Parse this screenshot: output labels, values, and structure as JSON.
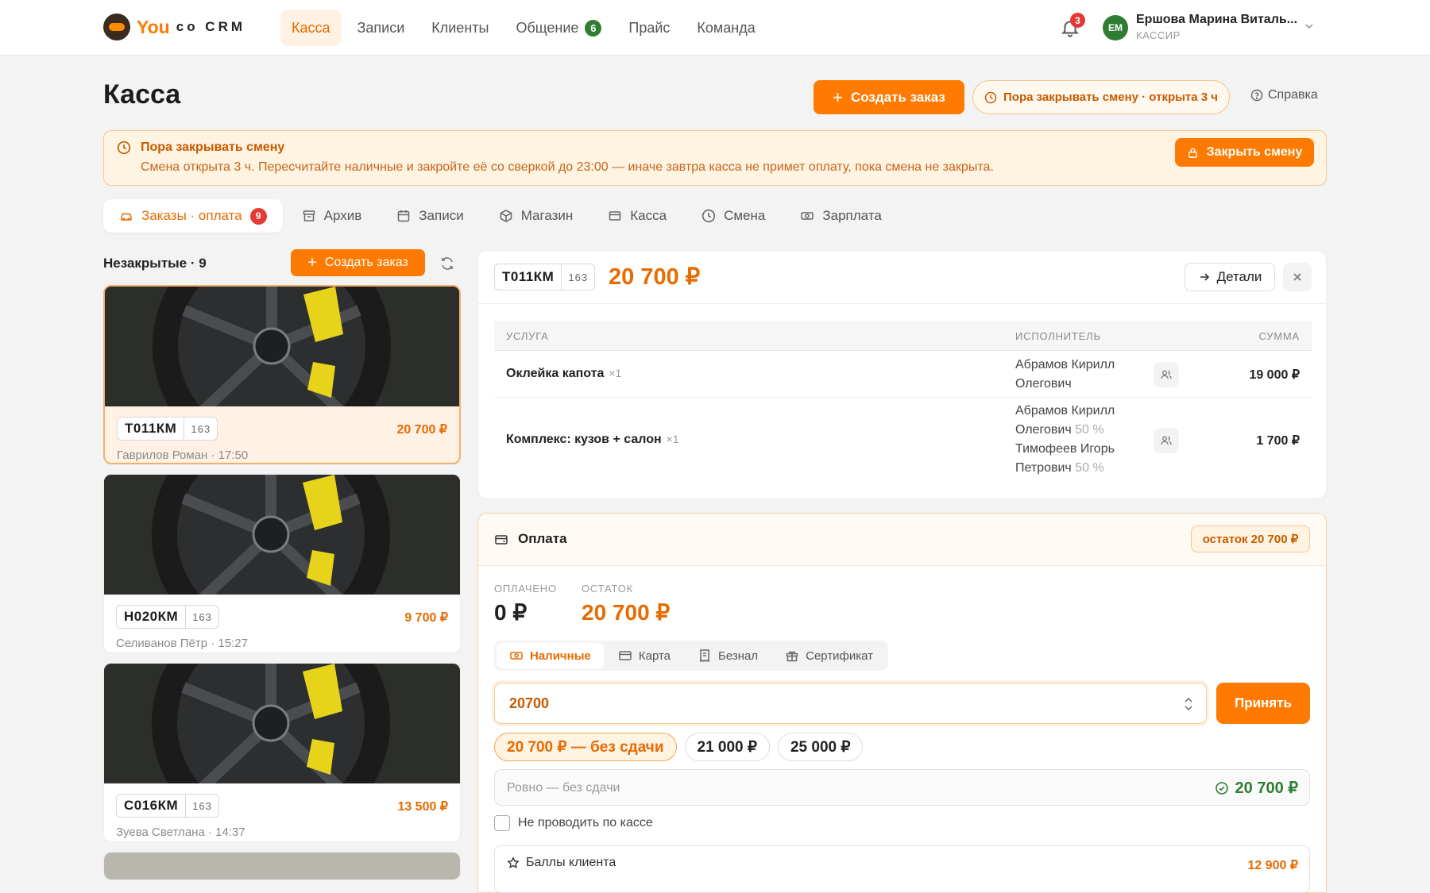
{
  "app": {
    "brand_you": "You",
    "brand_co": "co CRM"
  },
  "nav": [
    {
      "label": "Касса",
      "active": true
    },
    {
      "label": "Записи"
    },
    {
      "label": "Клиенты"
    },
    {
      "label": "Общение",
      "badge": "6"
    },
    {
      "label": "Прайс"
    },
    {
      "label": "Команда"
    }
  ],
  "notifications": {
    "count": "3"
  },
  "user": {
    "initials": "ЕМ",
    "name": "Ершова Марина Виталь...",
    "role": "КАССИР"
  },
  "header": {
    "title": "Касса",
    "create_label": "Создать заказ",
    "shift_label": "Пора закрывать смену · открыта 3 ч",
    "help_label": "Справка"
  },
  "alert": {
    "title": "Пора закрывать смену",
    "text": "Смена открыта 3 ч. Пересчитайте наличные и закройте её со сверкой до 23:00 — иначе завтра касса не примет оплату, пока смена не закрыта.",
    "button": "Закрыть смену"
  },
  "tabs": [
    {
      "label": "Заказы · оплата",
      "badge": "9",
      "icon": "car-icon",
      "active": true
    },
    {
      "label": "Архив",
      "icon": "archive-icon"
    },
    {
      "label": "Записи",
      "icon": "calendar-icon"
    },
    {
      "label": "Магазин",
      "icon": "box-icon"
    },
    {
      "label": "Касса",
      "icon": "register-icon"
    },
    {
      "label": "Смена",
      "icon": "clock-icon"
    },
    {
      "label": "Зарплата",
      "icon": "cash-icon"
    }
  ],
  "orders": {
    "title": "Незакрытые · 9",
    "create_label": "Создать заказ",
    "items": [
      {
        "plate": "Т011КМ",
        "region": "163",
        "sum": "20 700 ₽",
        "sub": "Гаврилов Роман · 17:50",
        "active": true
      },
      {
        "plate": "Н020КМ",
        "region": "163",
        "sum": "9 700 ₽",
        "sub": "Селиванов Пётр · 15:27"
      },
      {
        "plate": "С016КМ",
        "region": "163",
        "sum": "13 500 ₽",
        "sub": "Зуева Светлана · 14:37"
      }
    ]
  },
  "order": {
    "plate": "Т011КМ",
    "region": "163",
    "sum": "20 700 ₽",
    "details_label": "Детали",
    "columns": {
      "service": "УСЛУГА",
      "executor": "ИСПОЛНИТЕЛЬ",
      "amount": "СУММА"
    },
    "rows": [
      {
        "service": "Оклейка капота",
        "qty": "×1",
        "executors": [
          {
            "name": "Абрамов Кирилл",
            "name2": "Олегович",
            "pct": ""
          }
        ],
        "amount": "19 000 ₽"
      },
      {
        "service": "Комплекс: кузов + салон",
        "qty": "×1",
        "executors": [
          {
            "name": "Абрамов Кирилл",
            "name2": "Олегович",
            "pct": "50 %"
          },
          {
            "name": "Тимофеев Игорь",
            "name2": "Петрович",
            "pct": "50 %"
          }
        ],
        "amount": "1 700 ₽"
      }
    ]
  },
  "payment": {
    "title": "Оплата",
    "remain_badge": "остаток 20 700 ₽",
    "paid_label": "ОПЛАЧЕНО",
    "paid_value": "0 ₽",
    "remain_label": "ОСТАТОК",
    "remain_value": "20 700 ₽",
    "methods": [
      {
        "label": "Наличные",
        "icon": "cash-icon",
        "active": true
      },
      {
        "label": "Карта",
        "icon": "card-icon"
      },
      {
        "label": "Безнал",
        "icon": "receipt-icon"
      },
      {
        "label": "Сертификат",
        "icon": "gift-icon"
      }
    ],
    "amount_value": "20700",
    "accept_label": "Принять",
    "chips": [
      {
        "label": "20 700 ₽ — без сдачи",
        "active": true
      },
      {
        "label": "21 000 ₽"
      },
      {
        "label": "25 000 ₽"
      }
    ],
    "exact_label": "Ровно — без сдачи",
    "exact_value": "20 700 ₽",
    "no_register_label": "Не проводить по кассе",
    "bonus_label": "Баллы клиента",
    "bonus_value": "12 900 ₽"
  },
  "colors": {
    "accent": "#ff7a00",
    "success": "#2e7d32",
    "danger": "#e53935"
  }
}
